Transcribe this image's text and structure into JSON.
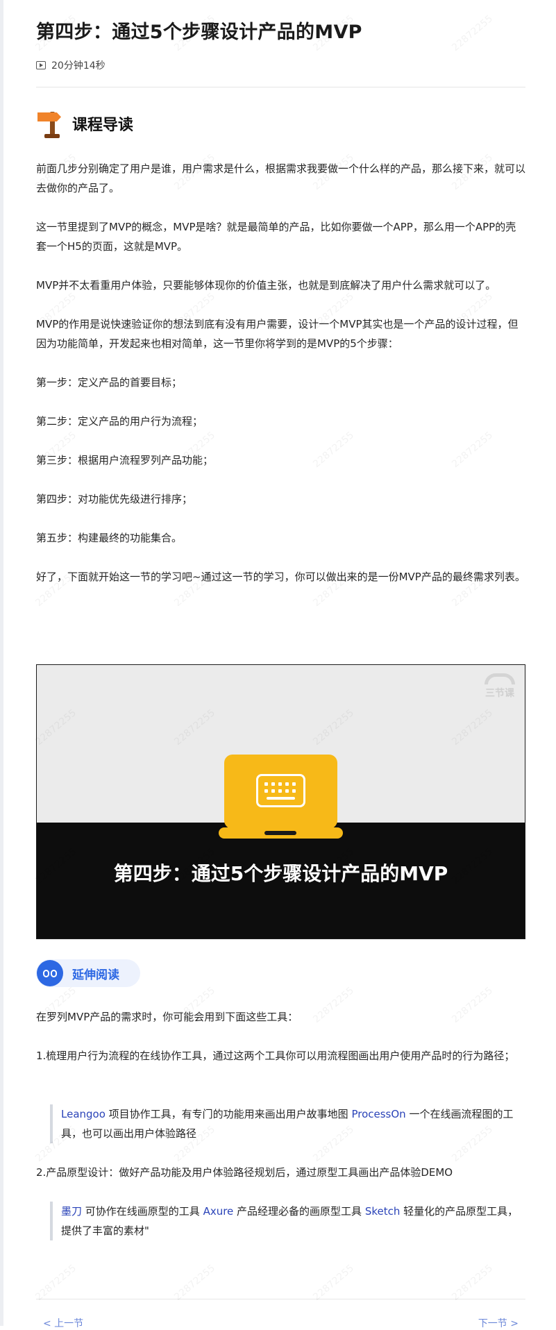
{
  "lesson": {
    "title": "第四步：通过5个步骤设计产品的MVP",
    "duration": "20分钟14秒"
  },
  "guide": {
    "heading": "课程导读",
    "paragraphs": [
      "前面几步分别确定了用户是谁，用户需求是什么，根据需求我要做一个什么样的产品，那么接下来，就可以去做你的产品了。",
      "这一节里提到了MVP的概念，MVP是啥？就是最简单的产品，比如你要做一个APP，那么用一个APP的壳套一个H5的页面，这就是MVP。",
      "MVP并不太看重用户体验，只要能够体现你的价值主张，也就是到底解决了用户什么需求就可以了。",
      "MVP的作用是说快速验证你的想法到底有没有用户需要，设计一个MVP其实也是一个产品的设计过程，但因为功能简单，开发起来也相对简单，这一节里你将学到的是MVP的5个步骤：",
      "第一步：定义产品的首要目标；",
      "第二步：定义产品的用户行为流程；",
      "第三步：根据用户流程罗列产品功能；",
      "第四步：对功能优先级进行排序；",
      "第五步：构建最终的功能集合。",
      "好了，下面就开始这一节的学习吧~通过这一节的学习，你可以做出来的是一份MVP产品的最终需求列表。"
    ]
  },
  "video": {
    "title": "第四步：通过5个步骤设计产品的MVP",
    "brand": "三节课"
  },
  "extended": {
    "label": "延伸阅读",
    "intro": "在罗列MVP产品的需求时，你可能会用到下面这些工具：",
    "item1": "1.梳理用户行为流程的在线协作工具，通过这两个工具你可以用流程图画出用户使用产品时的行为路径；",
    "quote1": {
      "link1": "Leangoo",
      "text1": " 项目协作工具，有专门的功能用来画出用户故事地图 ",
      "link2": "ProcessOn",
      "text2": " 一个在线画流程图的工具，也可以画出用户体验路径"
    },
    "item2": "2.产品原型设计：做好产品功能及用户体验路径规划后，通过原型工具画出产品体验DEMO",
    "quote2": {
      "link1": "墨刀",
      "text1": " 可协作在线画原型的工具 ",
      "link2": "Axure",
      "text2": " 产品经理必备的画原型工具 ",
      "link3": "Sketch",
      "text3": " 轻量化的产品原型工具，提供了丰富的素材\""
    }
  },
  "nav": {
    "prev": "< 上一节",
    "next": "下一节 >"
  },
  "watermark": "22872255"
}
